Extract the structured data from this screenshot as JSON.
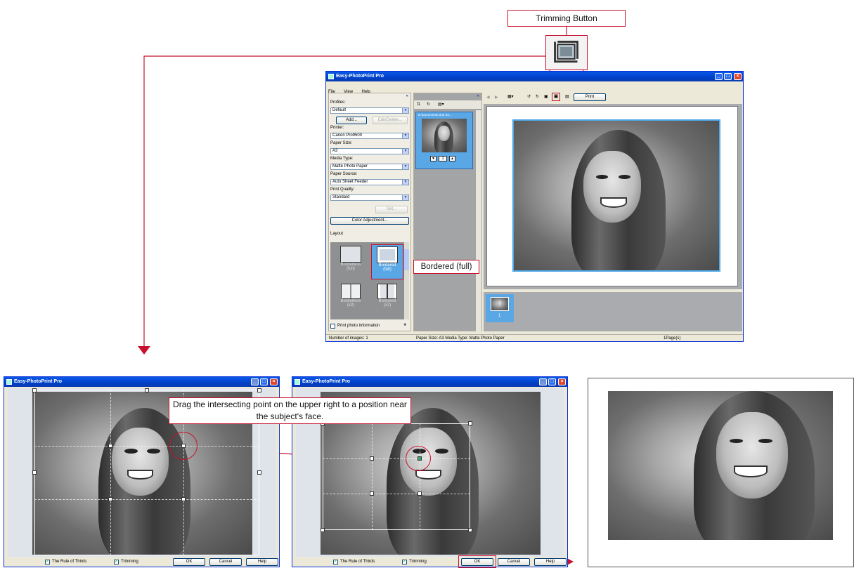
{
  "callouts": {
    "trimming_button": "Trimming Button",
    "bordered_full": "Bordered (full)",
    "drag_instruction": "Drag the intersecting point on the upper right to a position near the subject's face."
  },
  "main_window": {
    "title": "Easy-PhotoPrint Pro",
    "menu": [
      "File",
      "View",
      "Help"
    ],
    "profiles_label": "Profiles:",
    "profiles_value": "Default",
    "add_button": "Add...",
    "edit_delete_button": "Edit/Delete...",
    "printer_label": "Printer:",
    "printer_value": "Canon Pro9500",
    "paper_size_label": "Paper Size:",
    "paper_size_value": "A3",
    "media_type_label": "Media Type:",
    "media_type_value": "Matte Photo Paper",
    "paper_source_label": "Paper Source:",
    "paper_source_value": "Auto Sheet Feeder",
    "print_quality_label": "Print Quality:",
    "print_quality_value": "Standard",
    "set_button": "Set...",
    "color_adjustment_button": "Color Adjustment...",
    "layout_label": "Layout",
    "layouts": [
      {
        "line1": "Borderless",
        "line2": "(full)"
      },
      {
        "line1": "Bordered",
        "line2": "(full)"
      },
      {
        "line1": "Borderless",
        "line2": "(x2)"
      },
      {
        "line1": "Bordered",
        "line2": "(x2)"
      }
    ],
    "print_photo_info": "Print photo information",
    "thumb_path": "D:\\Documents and Se...",
    "thumb_count": "1",
    "print_button": "Print",
    "page_thumb_number": "1",
    "status_images": "Number of images: 1",
    "status_paper": "Paper Size: A3  Media Type: Matte Photo Paper",
    "status_pages": "1Page(s)"
  },
  "trim_window_left": {
    "title": "Easy-PhotoPrint Pro",
    "rule_of_thirds": "The Rule of Thirds",
    "trimming": "Trimming",
    "ok": "OK",
    "cancel": "Cancel",
    "help": "Help"
  },
  "trim_window_right": {
    "title": "Easy-PhotoPrint Pro",
    "rule_of_thirds": "The Rule of Thirds",
    "trimming": "Trimming",
    "ok": "OK",
    "cancel": "Cancel",
    "help": "Help"
  },
  "colors": {
    "accent_red": "#c8102e",
    "xp_blue": "#0054e3",
    "selected_blue": "#5aa7e6"
  }
}
